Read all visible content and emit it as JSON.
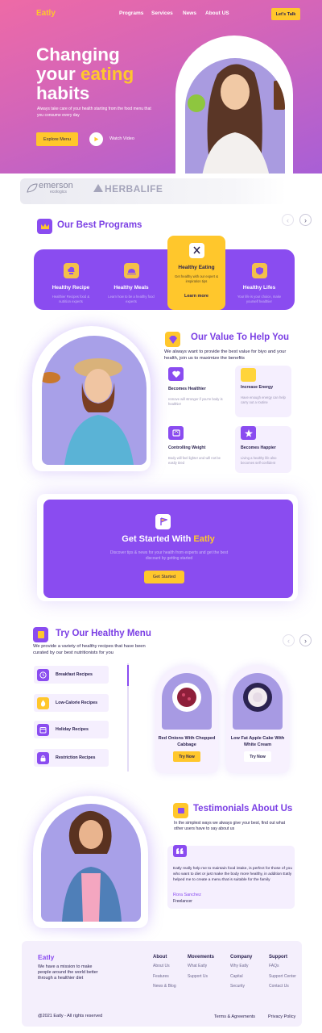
{
  "header": {
    "logo": "Eatly",
    "nav": [
      "Programs",
      "Services",
      "News",
      "About US"
    ],
    "cta": "Let's Talk"
  },
  "hero": {
    "title_line1": "Changing",
    "title_your": "your",
    "title_eating": "eating",
    "title_line3": "habits",
    "subtitle": "Always take care of your health starting from the food menu that you consume every day",
    "explore_label": "Explore Menu",
    "watch_label": "Watch Video"
  },
  "brands": {
    "brand1": "emerson",
    "brand1_sub": "ecologics",
    "brand2": "HERBALIFE"
  },
  "programs": {
    "title": "Our Best Programs",
    "items": [
      {
        "title": "Healthy Recipe",
        "desc": "Healthier Recipes food & nutrition experts"
      },
      {
        "title": "Healthy Meals",
        "desc": "Learn how to be a healthy food experts"
      },
      {
        "title": "Healthy Eating",
        "desc": "Get healthy with our expert & inspiration tips",
        "cta": "Learn more"
      },
      {
        "title": "Healthy Lifes",
        "desc": "Your life is your choice, make yourself healthier"
      }
    ]
  },
  "values": {
    "title": "Our Value To Help You",
    "desc": "We always want to provide the best value for biyo and your health, join us to maximize the benefits",
    "cards": [
      {
        "title": "Becomes Healthier",
        "desc": "remove will stronger if you're body is healthier",
        "color": "#8a4cf0"
      },
      {
        "title": "Increase Energy",
        "desc": "Have enough energy can help carry out a routine",
        "color": "#ffd43b"
      },
      {
        "title": "Controlling Weight",
        "desc": "Body will feel lighter and will not be easily tired",
        "color": "#8a4cf0"
      },
      {
        "title": "Becomes Happier",
        "desc": "Living a healthy life also becomes self-confident",
        "color": "#8a4cf0"
      }
    ]
  },
  "get_started": {
    "title_prefix": "Get Started With",
    "title_brand": "Eatly",
    "subtitle": "Discover tips & news for your health from experts and get the best discount by getting started",
    "button": "Get Started"
  },
  "menu": {
    "title": "Try Our Healthy Menu",
    "desc": "We provide a variety of healthy recipes that have been curated by our best nutritionists for you",
    "categories": [
      "Breakfast Recipes",
      "Low-Calorie Recipes",
      "Holiday Recipes",
      "Restriction Recipes"
    ],
    "dishes": [
      {
        "name": "Red Onions With Chopped Cabbage",
        "button": "Try Now"
      },
      {
        "name": "Low Fat Apple Cake With White Cream",
        "button": "Try Now"
      }
    ]
  },
  "testimonials": {
    "title": "Testimonials About Us",
    "desc": "In the simplest ways we always give your best, find out what other users have to say about us",
    "quote": "Eatly really help me to maintain food intake, is perfect for those of you who want to diet or just make the body more healthy, in addition Eatly helped me to create a menu that is suitable for the family",
    "name": "Rora Sanchez",
    "role": "Freelancer"
  },
  "footer": {
    "logo": "Eatly",
    "mission": "We have a mission to make people around the world better through a healthier diet",
    "columns": [
      {
        "title": "About",
        "links": [
          "About Us",
          "Features",
          "News & Blog"
        ]
      },
      {
        "title": "Movements",
        "links": [
          "What Eatly",
          "Support Us"
        ]
      },
      {
        "title": "Company",
        "links": [
          "Why Eatly",
          "Capital",
          "Security"
        ]
      },
      {
        "title": "Support",
        "links": [
          "FAQs",
          "Support Center",
          "Contact Us"
        ]
      }
    ],
    "copyright": "@2021 Eatly - All rights reserved",
    "terms": "Terms & Agreements",
    "privacy": "Privacy Policy"
  },
  "colors": {
    "primary": "#8a4cf0",
    "accent": "#ffc72c",
    "hero_gradient_start": "#ee6aa6",
    "hero_gradient_end": "#a85fd6"
  }
}
